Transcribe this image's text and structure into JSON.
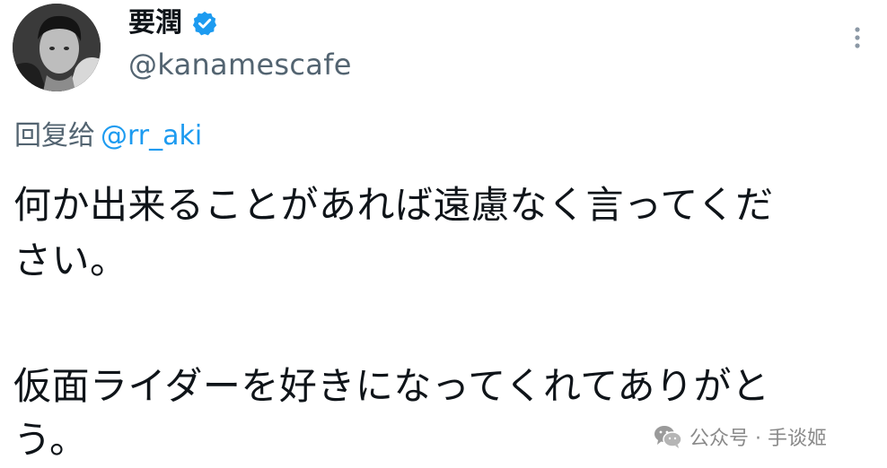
{
  "author": {
    "display_name": "要潤",
    "handle": "@kanamescafe",
    "verified_icon": "verified-badge-icon",
    "avatar_icon": "profile-avatar"
  },
  "more_icon": "more-vertical-icon",
  "reply": {
    "prefix": "回复给",
    "mention": "@rr_aki"
  },
  "tweet": {
    "line1": "何か出来ることがあれば遠慮なく言ってくだ",
    "line2": "さい。",
    "line3": "仮面ライダーを好きになってくれてありがと",
    "line4": "う。"
  },
  "watermark": {
    "icon": "wechat-icon",
    "text": "公众号 · 手谈姬"
  },
  "colors": {
    "text": "#0f1419",
    "secondary": "#536471",
    "accent": "#1d9bf0",
    "watermark": "#8a8a8a"
  }
}
